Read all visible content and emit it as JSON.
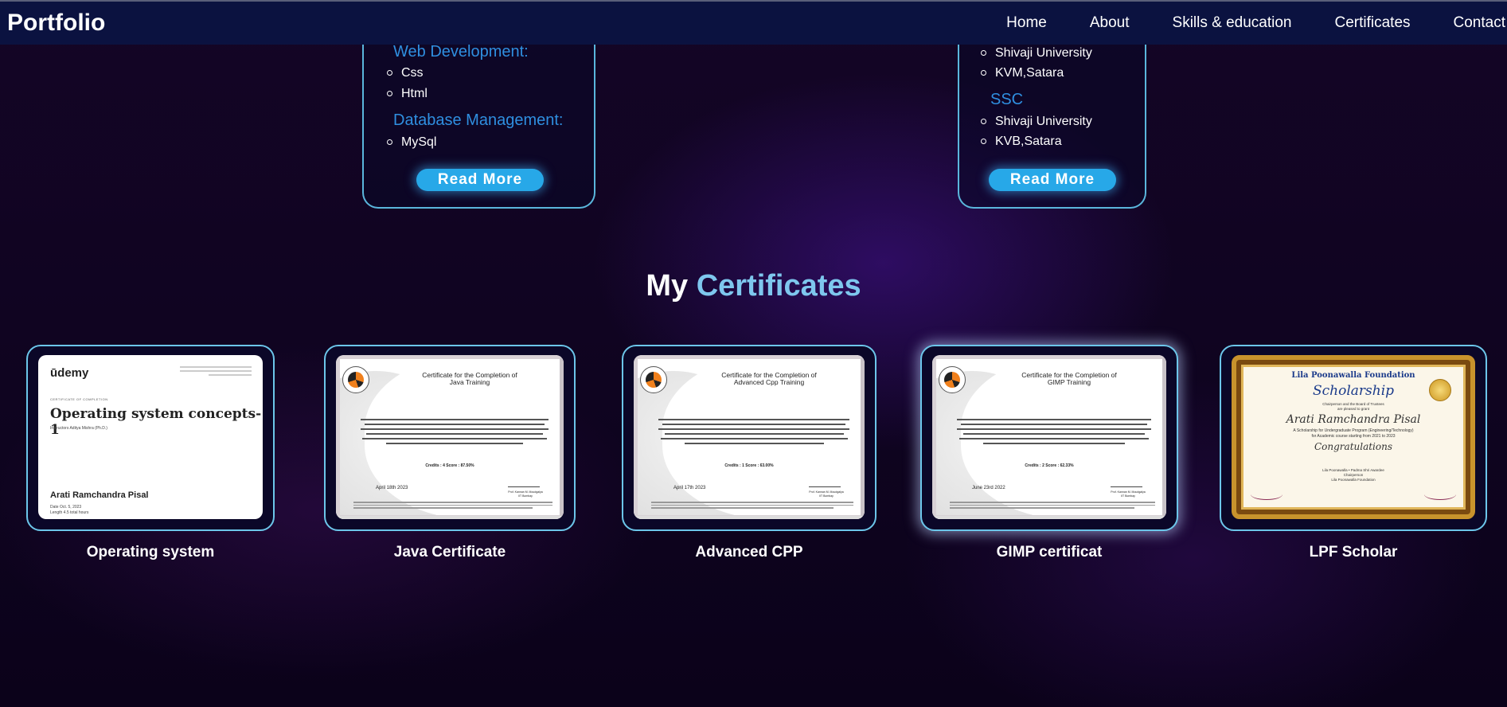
{
  "navbar": {
    "brand": "Portfolio",
    "links": [
      "Home",
      "About",
      "Skills & education",
      "Certificates",
      "Contact"
    ]
  },
  "skills_card": {
    "categories": [
      {
        "title": "Web Development:",
        "items": [
          "Css",
          "Html"
        ]
      },
      {
        "title": "Database Management:",
        "items": [
          "MySql"
        ]
      }
    ],
    "button": "Read More"
  },
  "education_card": {
    "top_items": [
      "Shivaji University",
      "KVM,Satara"
    ],
    "section": {
      "title": "SSC",
      "items": [
        "Shivaji University",
        "KVB,Satara"
      ]
    },
    "button": "Read More"
  },
  "certificates_section": {
    "title_prefix": "My",
    "title_accent": "Certificates",
    "accent_color": "#7ec7ee"
  },
  "certificates": [
    {
      "caption": "Operating system",
      "image": {
        "logo": "ūdemy",
        "label": "CERTIFICATE OF COMPLETION",
        "course": "Operating system concepts-1",
        "instructors": "Instructors  Aditya Mishra (Ph.D.)",
        "name": "Arati Ramchandra Pisal",
        "date": "Date  Oct. 5, 2023",
        "length": "Length  4.5 total hours"
      }
    },
    {
      "caption": "Java Certificate",
      "image": {
        "title": "Certificate for the Completion of\nJava Training",
        "date": "April 18th 2023",
        "credits": "Credits : 4    Score : 87.50%",
        "signer": "Prof. Kannan M. Moudgalya\nIIT Bombay"
      }
    },
    {
      "caption": "Advanced CPP",
      "image": {
        "title": "Certificate for the Completion of\nAdvanced Cpp Training",
        "date": "April 17th 2023",
        "credits": "Credits : 1    Score : 63.00%",
        "signer": "Prof. Kannan M. Moudgalya\nIIT Bombay"
      }
    },
    {
      "caption": "GIMP certificat",
      "image": {
        "title": "Certificate for the Completion of\nGIMP Training",
        "date": "June 23rd 2022",
        "credits": "Credits : 2    Score : 62.33%",
        "signer": "Prof. Kannan M. Moudgalya\nIIT Bombay"
      }
    },
    {
      "caption": "LPF Scholar",
      "image": {
        "org": "Lila Poonawalla Foundation",
        "heading": "Scholarship",
        "sub": "Chairperson and the Board of Trustees\nare pleased to grant",
        "name": "Arati Ramchandra Pisal",
        "desc": "A Scholarship for Undergraduate Program (Engineering/Technology)\nfor Academic course starting from 2021 to 2023",
        "congrats": "Congratulations",
        "signer": "Lila Poonawalla • Padma Shri Awardee\nChairperson\nLila Poonawalla Foundation"
      }
    }
  ]
}
